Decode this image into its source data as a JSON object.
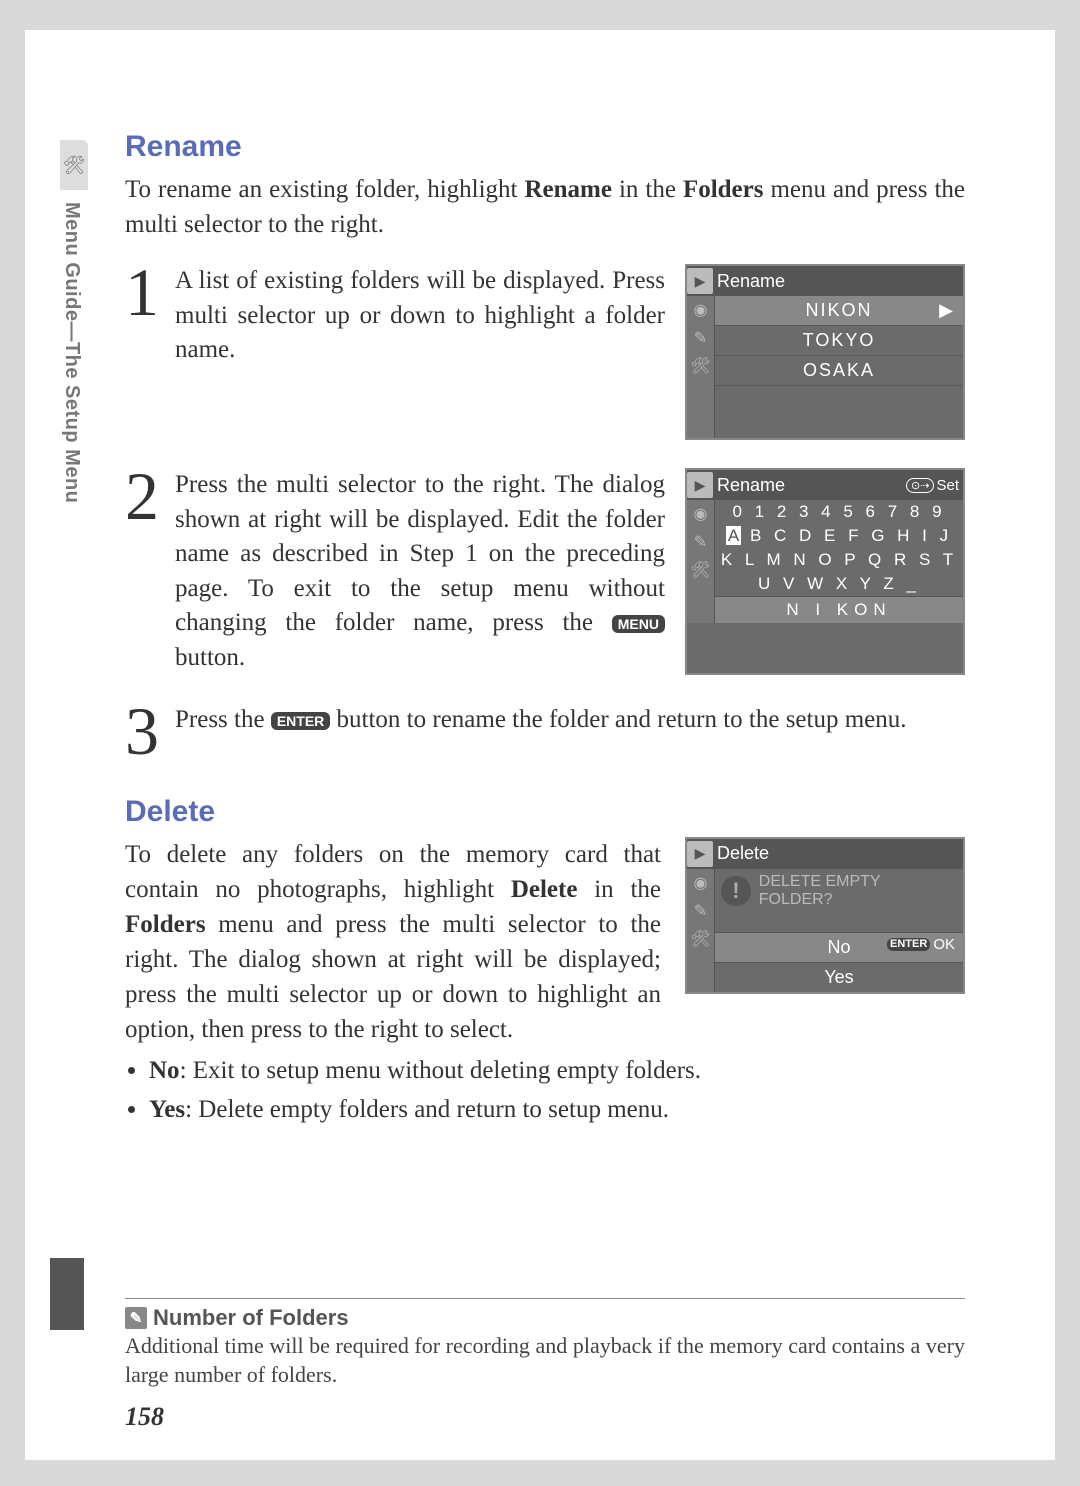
{
  "sidebar": {
    "label": "Menu Guide—The Setup Menu"
  },
  "rename": {
    "heading": "Rename",
    "intro_pre": "To rename an existing folder, highlight ",
    "intro_b1": "Rename",
    "intro_mid": " in the ",
    "intro_b2": "Folders",
    "intro_post": " menu and press the multi selector to the right.",
    "step1": "A list of existing folders will be displayed. Press multi selector up or down to highlight a folder name.",
    "step2_pre": "Press the multi selector to the right. The dialog shown at right will be displayed. Edit the folder name as described in Step 1 on the preceding page. To exit to the setup menu without changing the folder name, press the ",
    "step2_btn": "MENU",
    "step2_post": " button.",
    "step3_pre": "Press the ",
    "step3_btn": "ENTER",
    "step3_post": " button to rename the folder and return to the setup menu."
  },
  "screen1": {
    "title": "Rename",
    "items": [
      "NIKON",
      "TOKYO",
      "OSAKA"
    ]
  },
  "screen2": {
    "title": "Rename",
    "set": "Set",
    "row1": "0 1 2 3 4 5 6 7 8 9",
    "row2_first": "A",
    "row2_rest": "B C D E F G H I J",
    "row3": "K L M N O P Q R S T",
    "row4": "U V W X Y Z _",
    "entry": "N I KON"
  },
  "delete": {
    "heading": "Delete",
    "para_pre": "To delete any folders on the memory card that contain no photographs, highlight ",
    "para_b1": "Delete",
    "para_mid": " in the ",
    "para_b2": "Folders",
    "para_post": " menu and press the multi selector to the right. The dialog shown at right will be displayed; press the multi selector up or down to highlight an option, then press to the right to select.",
    "bullet_no_b": "No",
    "bullet_no": ": Exit to setup menu without deleting empty folders.",
    "bullet_yes_b": "Yes",
    "bullet_yes": ": Delete empty folders and return to setup menu."
  },
  "screen3": {
    "title": "Delete",
    "prompt": "DELETE EMPTY FOLDER?",
    "opt_no": "No",
    "opt_yes": "Yes",
    "ok": "OK",
    "enter": "ENTER"
  },
  "note": {
    "heading": "Number of Folders",
    "body": "Additional time will be required for recording and playback if the memory card contains a very large number of folders."
  },
  "page_number": "158"
}
